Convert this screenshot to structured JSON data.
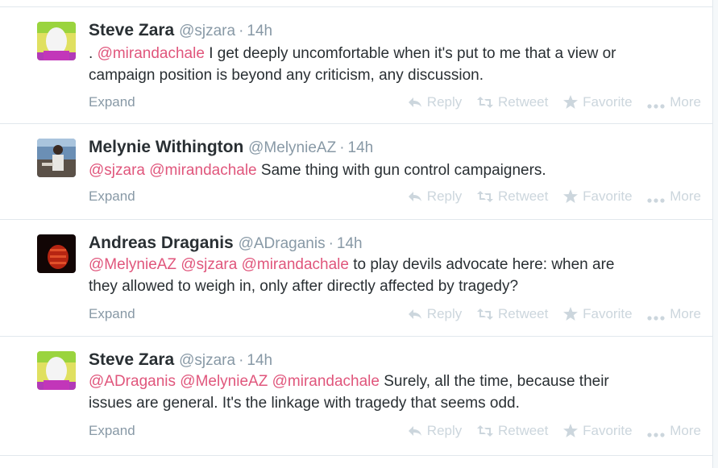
{
  "actions": {
    "expand": "Expand",
    "reply": "Reply",
    "retweet": "Retweet",
    "favorite": "Favorite",
    "more": "More"
  },
  "tweets": [
    {
      "fullname": "Steve Zara",
      "username": "@sjzara",
      "separator": "·",
      "time": "14h",
      "text": {
        "prefix": ". ",
        "mentions": [
          "@mirandachale"
        ],
        "line1": " I get deeply uncomfortable when it's put to me that a view or",
        "line2": "campaign position is beyond any criticism, any discussion."
      }
    },
    {
      "fullname": "Melynie Withington",
      "username": "@MelynieAZ",
      "separator": "·",
      "time": "14h",
      "text": {
        "mentions": [
          "@sjzara",
          "@mirandachale"
        ],
        "line1": " Same thing with gun control campaigners."
      }
    },
    {
      "fullname": "Andreas Draganis",
      "username": "@ADraganis",
      "separator": "·",
      "time": "14h",
      "text": {
        "mentions": [
          "@MelynieAZ",
          "@sjzara",
          "@mirandachale"
        ],
        "line1": " to play devils advocate here: when are",
        "line2": "they allowed to weigh in, only after directly affected by tragedy?"
      }
    },
    {
      "fullname": "Steve Zara",
      "username": "@sjzara",
      "separator": "·",
      "time": "14h",
      "text": {
        "mentions": [
          "@ADraganis",
          "@MelynieAZ",
          "@mirandachale"
        ],
        "line1": " Surely, all the time, because their",
        "line2": "issues are general.  It's the linkage with tragedy that seems odd."
      }
    }
  ],
  "colors": {
    "mention": "#e0567c",
    "meta": "#8899a6",
    "action_inactive": "#ccd6dd"
  }
}
